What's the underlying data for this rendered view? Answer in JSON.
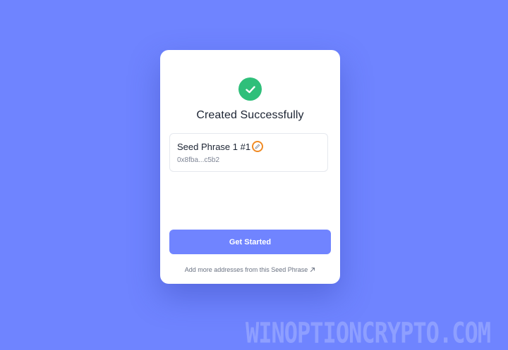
{
  "dialog": {
    "title": "Created Successfully",
    "status_icon": "check-circle-icon",
    "success_color": "#2fbf7a"
  },
  "account": {
    "name": "Seed Phrase 1 #1",
    "address": "0x8fba...c5b2",
    "edit_icon": "pencil-icon",
    "highlight_color": "#f08a24"
  },
  "actions": {
    "primary_label": "Get Started",
    "primary_color": "#7084ff",
    "secondary_label": "Add more addresses from this Seed Phrase",
    "secondary_icon": "arrow-up-right-icon"
  },
  "background_color": "#6f84ff",
  "watermark": "WINOPTIONCRYPTO.COM"
}
